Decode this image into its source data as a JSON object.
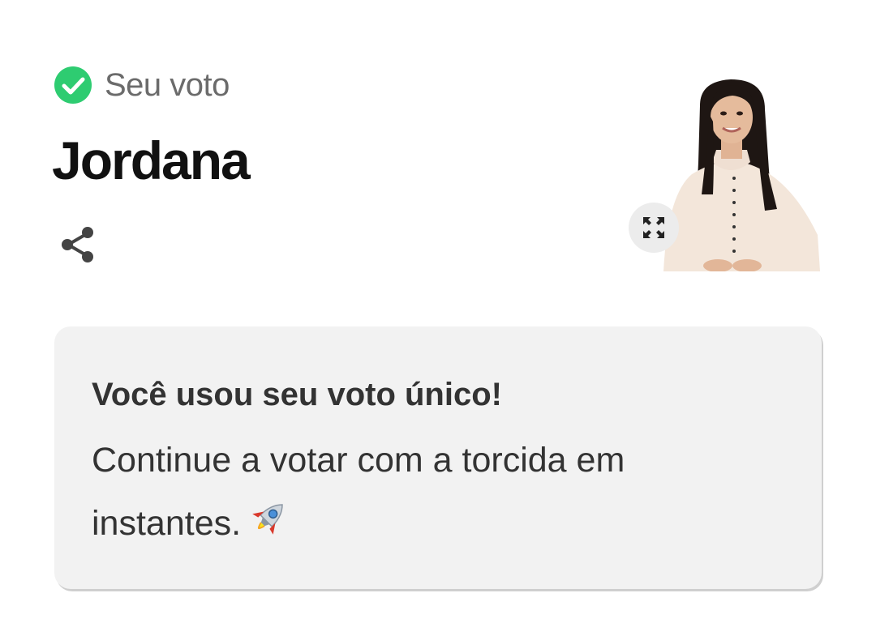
{
  "vote": {
    "status_label": "Seu voto",
    "candidate_name": "Jordana"
  },
  "card": {
    "title": "Você usou seu voto único!",
    "body": "Continue a votar com a torcida em instantes."
  },
  "icons": {
    "status": "check-circle-icon",
    "share": "share-icon",
    "expand": "expand-icon",
    "emoji": "rocket-icon"
  },
  "colors": {
    "check_green": "#2ecc71",
    "card_background": "#f2f2f2",
    "name_text": "#111111",
    "body_text": "#333333"
  }
}
